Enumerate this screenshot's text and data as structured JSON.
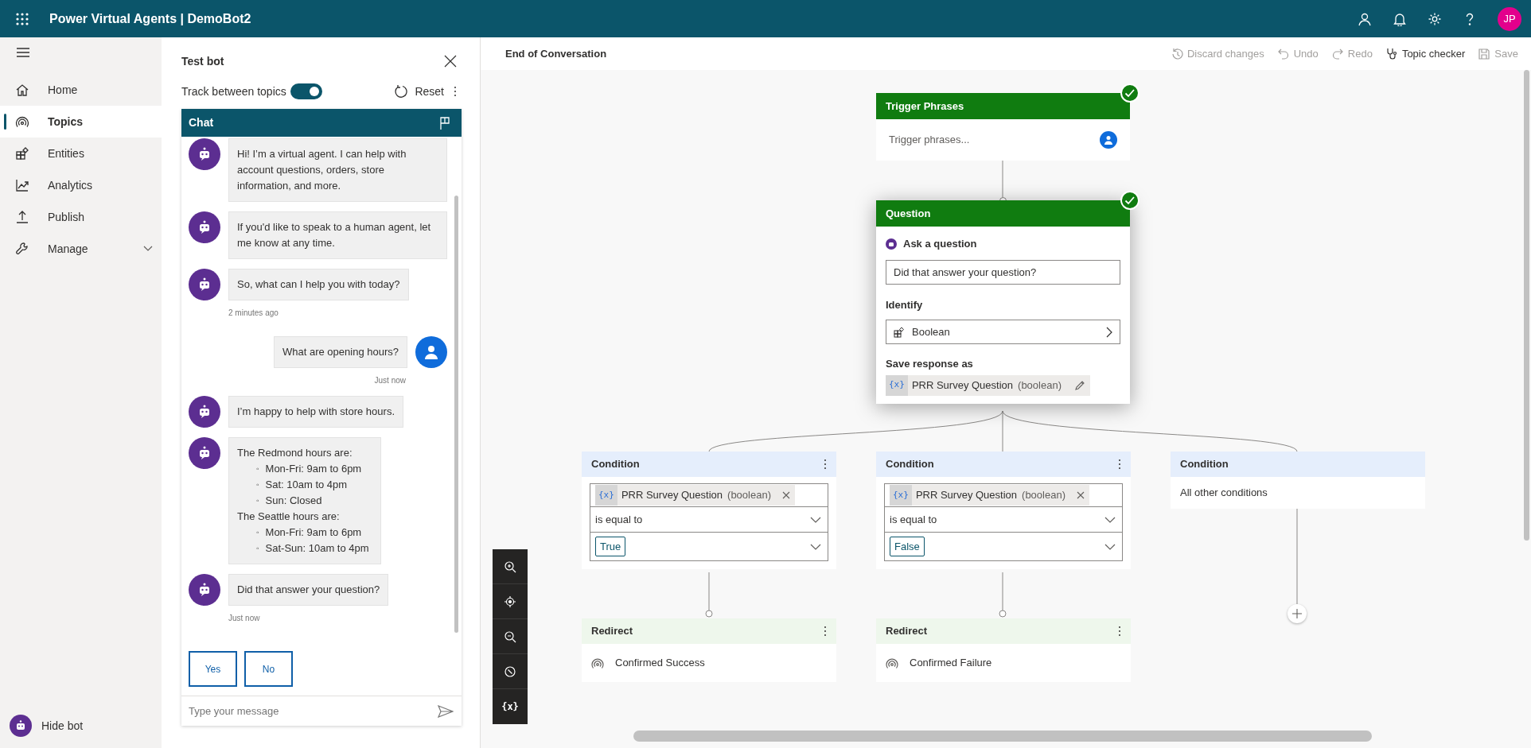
{
  "app": {
    "title": "Power Virtual Agents | DemoBot2",
    "avatar_initials": "JP"
  },
  "nav": {
    "items": [
      {
        "label": "Home",
        "selected": false
      },
      {
        "label": "Topics",
        "selected": true
      },
      {
        "label": "Entities",
        "selected": false
      },
      {
        "label": "Analytics",
        "selected": false
      },
      {
        "label": "Publish",
        "selected": false
      },
      {
        "label": "Manage",
        "selected": false,
        "expanded": false
      }
    ],
    "hide_bot": "Hide bot"
  },
  "test_bot": {
    "title": "Test bot",
    "track_label": "Track between topics",
    "track_on": true,
    "reset": "Reset",
    "chat_title": "Chat",
    "messages": [
      {
        "kind": "bot",
        "text": "Hi! I’m a virtual agent. I can help with account questions, orders, store information, and more."
      },
      {
        "kind": "bot",
        "text": "If you'd like to speak to a human agent, let me know at any time."
      },
      {
        "kind": "bot",
        "text": "So, what can I help you with today?",
        "time": "2 minutes ago"
      },
      {
        "kind": "user",
        "text": "What are opening hours?",
        "time": "Just now"
      },
      {
        "kind": "bot",
        "text": "I’m happy to help with store hours."
      },
      {
        "kind": "bot_list",
        "groups": [
          {
            "heading": "The Redmond hours are:",
            "items": [
              {
                "bullet": "◦",
                "text": "Mon-Fri: 9am to 6pm"
              },
              {
                "bullet": "◦",
                "text": "Sat: 10am to 4pm"
              },
              {
                "bullet": "◦",
                "text": "Sun: Closed"
              }
            ]
          },
          {
            "heading": "The Seattle hours are:",
            "items": [
              {
                "bullet": "◦",
                "text": "Mon-Fri: 9am to 6pm"
              },
              {
                "bullet": "◦",
                "text": "Sat-Sun: 10am to 4pm"
              }
            ]
          }
        ]
      },
      {
        "kind": "bot",
        "text": "Did that answer your question?",
        "time": "Just now"
      }
    ],
    "quick_replies": [
      "Yes",
      "No"
    ],
    "input": {
      "placeholder": "Type your message"
    }
  },
  "canvas": {
    "title": "End of Conversation",
    "toolbar": [
      {
        "label": "Discard changes",
        "disabled": true
      },
      {
        "label": "Undo",
        "disabled": true
      },
      {
        "label": "Redo",
        "disabled": true
      },
      {
        "label": "Topic checker",
        "disabled": false
      },
      {
        "label": "Save",
        "disabled": true
      }
    ],
    "trigger": {
      "title": "Trigger Phrases",
      "placeholder": "Trigger phrases...",
      "validated": true
    },
    "question": {
      "title": "Question",
      "validated": true,
      "ask_label": "Ask a question",
      "question_text": "Did that answer your question?",
      "identify_label": "Identify",
      "identify_value": "Boolean",
      "save_label": "Save response as",
      "variable_icon": "{x}",
      "variable_name": "PRR Survey Question",
      "variable_type": "(boolean)"
    },
    "conditions": [
      {
        "kind": "expression",
        "title": "Condition",
        "variable_icon": "{x}",
        "variable_name": "PRR Survey Question",
        "variable_type": "(boolean)",
        "operator": "is equal to",
        "value": "True"
      },
      {
        "kind": "expression",
        "title": "Condition",
        "variable_icon": "{x}",
        "variable_name": "PRR Survey Question",
        "variable_type": "(boolean)",
        "operator": "is equal to",
        "value": "False"
      },
      {
        "kind": "else",
        "title": "Condition",
        "text": "All other conditions"
      }
    ],
    "redirects": [
      {
        "title": "Redirect",
        "target": "Confirmed Success"
      },
      {
        "title": "Redirect",
        "target": "Confirmed Failure"
      }
    ],
    "variables_button": "{x}"
  }
}
